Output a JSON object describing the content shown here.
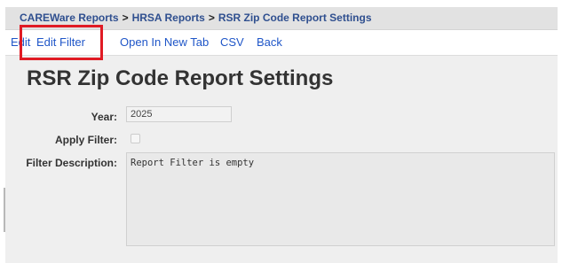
{
  "breadcrumb": {
    "items": [
      {
        "label": "CAREWare Reports"
      },
      {
        "label": "HRSA Reports"
      },
      {
        "label": "RSR Zip Code Report Settings"
      }
    ],
    "separator": ">"
  },
  "menu": {
    "items": [
      {
        "label": "Edit"
      },
      {
        "label": "Edit Filter",
        "highlighted": true
      },
      {
        "label": "Open In New Tab"
      },
      {
        "label": "CSV"
      },
      {
        "label": "Back"
      }
    ]
  },
  "page": {
    "title": "RSR Zip Code Report Settings"
  },
  "form": {
    "year": {
      "label": "Year:",
      "value": "2025"
    },
    "apply_filter": {
      "label": "Apply Filter:",
      "checked": false
    },
    "filter_description": {
      "label": "Filter Description:",
      "value": "Report Filter is empty"
    }
  },
  "colors": {
    "link": "#1f56c8",
    "breadcrumb_link": "#2f4f8f",
    "highlight": "#e01b24",
    "content_bg": "#efefef"
  }
}
